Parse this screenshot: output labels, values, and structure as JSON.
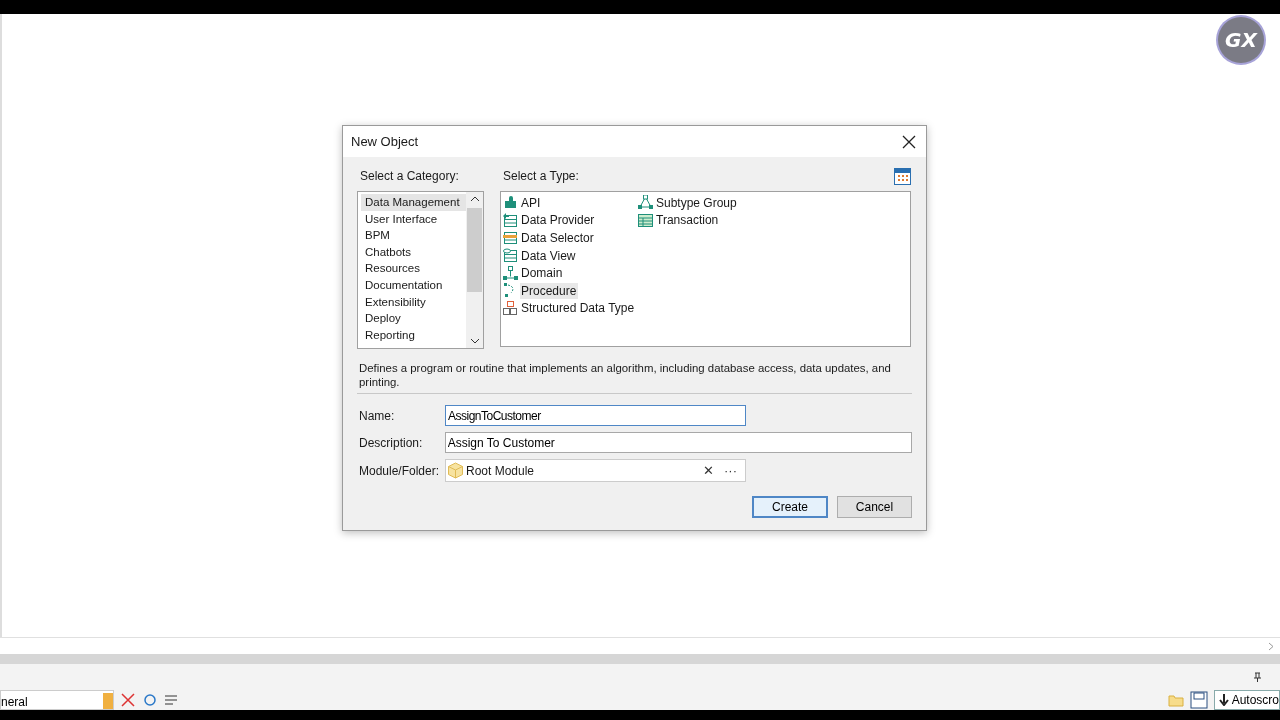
{
  "badge": {
    "text": "GX"
  },
  "dialog": {
    "title": "New Object",
    "category_label": "Select a Category:",
    "type_label": "Select a Type:",
    "categories": [
      {
        "label": "Data Management",
        "selected": true
      },
      {
        "label": "User Interface",
        "selected": false
      },
      {
        "label": "BPM",
        "selected": false
      },
      {
        "label": "Chatbots",
        "selected": false
      },
      {
        "label": "Resources",
        "selected": false
      },
      {
        "label": "Documentation",
        "selected": false
      },
      {
        "label": "Extensibility",
        "selected": false
      },
      {
        "label": "Deploy",
        "selected": false
      },
      {
        "label": "Reporting",
        "selected": false
      }
    ],
    "types": [
      {
        "label": "API",
        "kind": "api",
        "selected": false
      },
      {
        "label": "Data Provider",
        "kind": "provider",
        "selected": false
      },
      {
        "label": "Data Selector",
        "kind": "selector",
        "selected": false
      },
      {
        "label": "Data View",
        "kind": "view",
        "selected": false
      },
      {
        "label": "Domain",
        "kind": "domain",
        "selected": false
      },
      {
        "label": "Procedure",
        "kind": "procedure",
        "selected": true
      },
      {
        "label": "Structured Data Type",
        "kind": "sdt",
        "selected": false
      },
      {
        "label": "Subtype Group",
        "kind": "subtype",
        "selected": false
      },
      {
        "label": "Transaction",
        "kind": "transaction",
        "selected": false
      }
    ],
    "description": "Defines a program or routine that implements an algorithm, including database access, data updates, and printing.",
    "fields": [
      {
        "label": "Name:",
        "value": "AssignToCustomer",
        "focused": true
      },
      {
        "label": "Description:",
        "value": "Assign To Customer",
        "focused": false
      }
    ],
    "module": {
      "label": "Module/Folder:",
      "value": "Root Module",
      "clear": "✕",
      "more": "···"
    },
    "buttons": [
      {
        "label": "Create",
        "default": true
      },
      {
        "label": "Cancel",
        "default": false
      }
    ]
  },
  "bottom": {
    "combo_value": "neral",
    "autoscroll": "Autoscro"
  }
}
